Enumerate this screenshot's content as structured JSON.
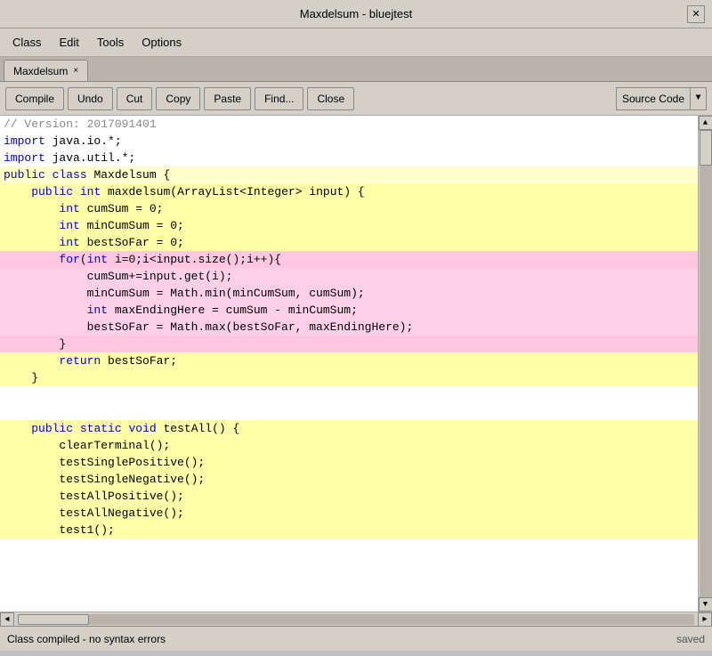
{
  "titlebar": {
    "title": "Maxdelsum - bluejtest",
    "close_label": "✕"
  },
  "menubar": {
    "items": [
      "Class",
      "Edit",
      "Tools",
      "Options"
    ]
  },
  "tab": {
    "label": "Maxdelsum",
    "close": "×"
  },
  "toolbar": {
    "compile": "Compile",
    "undo": "Undo",
    "cut": "Cut",
    "copy": "Copy",
    "paste": "Paste",
    "find": "Find...",
    "close": "Close",
    "source_code": "Source Code",
    "dropdown_arrow": "▼"
  },
  "statusbar": {
    "message": "Class compiled - no syntax errors",
    "saved": "saved"
  },
  "code": {
    "lines": [
      {
        "text": "// Version: 2017091401",
        "bg": "white"
      },
      {
        "text": "import java.io.*;",
        "bg": "white"
      },
      {
        "text": "import java.util.*;",
        "bg": "white"
      },
      {
        "text": "public class Maxdelsum {",
        "bg": "yellow-light"
      },
      {
        "text": "    public int maxdelsum(ArrayList<Integer> input) {",
        "bg": "yellow-mid"
      },
      {
        "text": "        int cumSum = 0;",
        "bg": "yellow-mid"
      },
      {
        "text": "        int minCumSum = 0;",
        "bg": "yellow-mid"
      },
      {
        "text": "        int bestSoFar = 0;",
        "bg": "yellow-mid"
      },
      {
        "text": "        for(int i=0;i<input.size();i++){",
        "bg": "pink2"
      },
      {
        "text": "            cumSum+=input.get(i);",
        "bg": "pink"
      },
      {
        "text": "            minCumSum = Math.min(minCumSum, cumSum);",
        "bg": "pink"
      },
      {
        "text": "            int maxEndingHere = cumSum - minCumSum;",
        "bg": "pink"
      },
      {
        "text": "            bestSoFar = Math.max(bestSoFar, maxEndingHere);",
        "bg": "pink"
      },
      {
        "text": "        }",
        "bg": "pink2"
      },
      {
        "text": "        return bestSoFar;",
        "bg": "yellow-mid"
      },
      {
        "text": "    }",
        "bg": "yellow-mid"
      },
      {
        "text": "",
        "bg": "white"
      },
      {
        "text": "",
        "bg": "white"
      },
      {
        "text": "    public static void testAll() {",
        "bg": "yellow-mid"
      },
      {
        "text": "        clearTerminal();",
        "bg": "yellow-mid"
      },
      {
        "text": "        testSinglePositive();",
        "bg": "yellow-mid"
      },
      {
        "text": "        testSingleNegative();",
        "bg": "yellow-mid"
      },
      {
        "text": "        testAllPositive();",
        "bg": "yellow-mid"
      },
      {
        "text": "        testAllNegative();",
        "bg": "yellow-mid"
      },
      {
        "text": "        test1();",
        "bg": "yellow-mid"
      }
    ]
  }
}
